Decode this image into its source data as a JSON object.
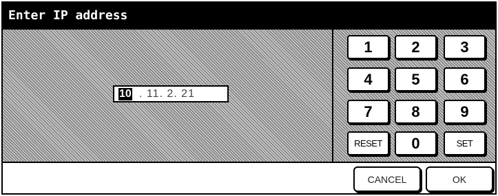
{
  "window": {
    "title": "Enter IP address"
  },
  "ip_input": {
    "cursor_segment": "10",
    "remaining": ". 11. 2. 21"
  },
  "keypad": {
    "keys": [
      "1",
      "2",
      "3",
      "4",
      "5",
      "6",
      "7",
      "8",
      "9",
      "RESET",
      "0",
      "SET"
    ]
  },
  "footer": {
    "cancel_label": "CANCEL",
    "ok_label": "OK"
  }
}
